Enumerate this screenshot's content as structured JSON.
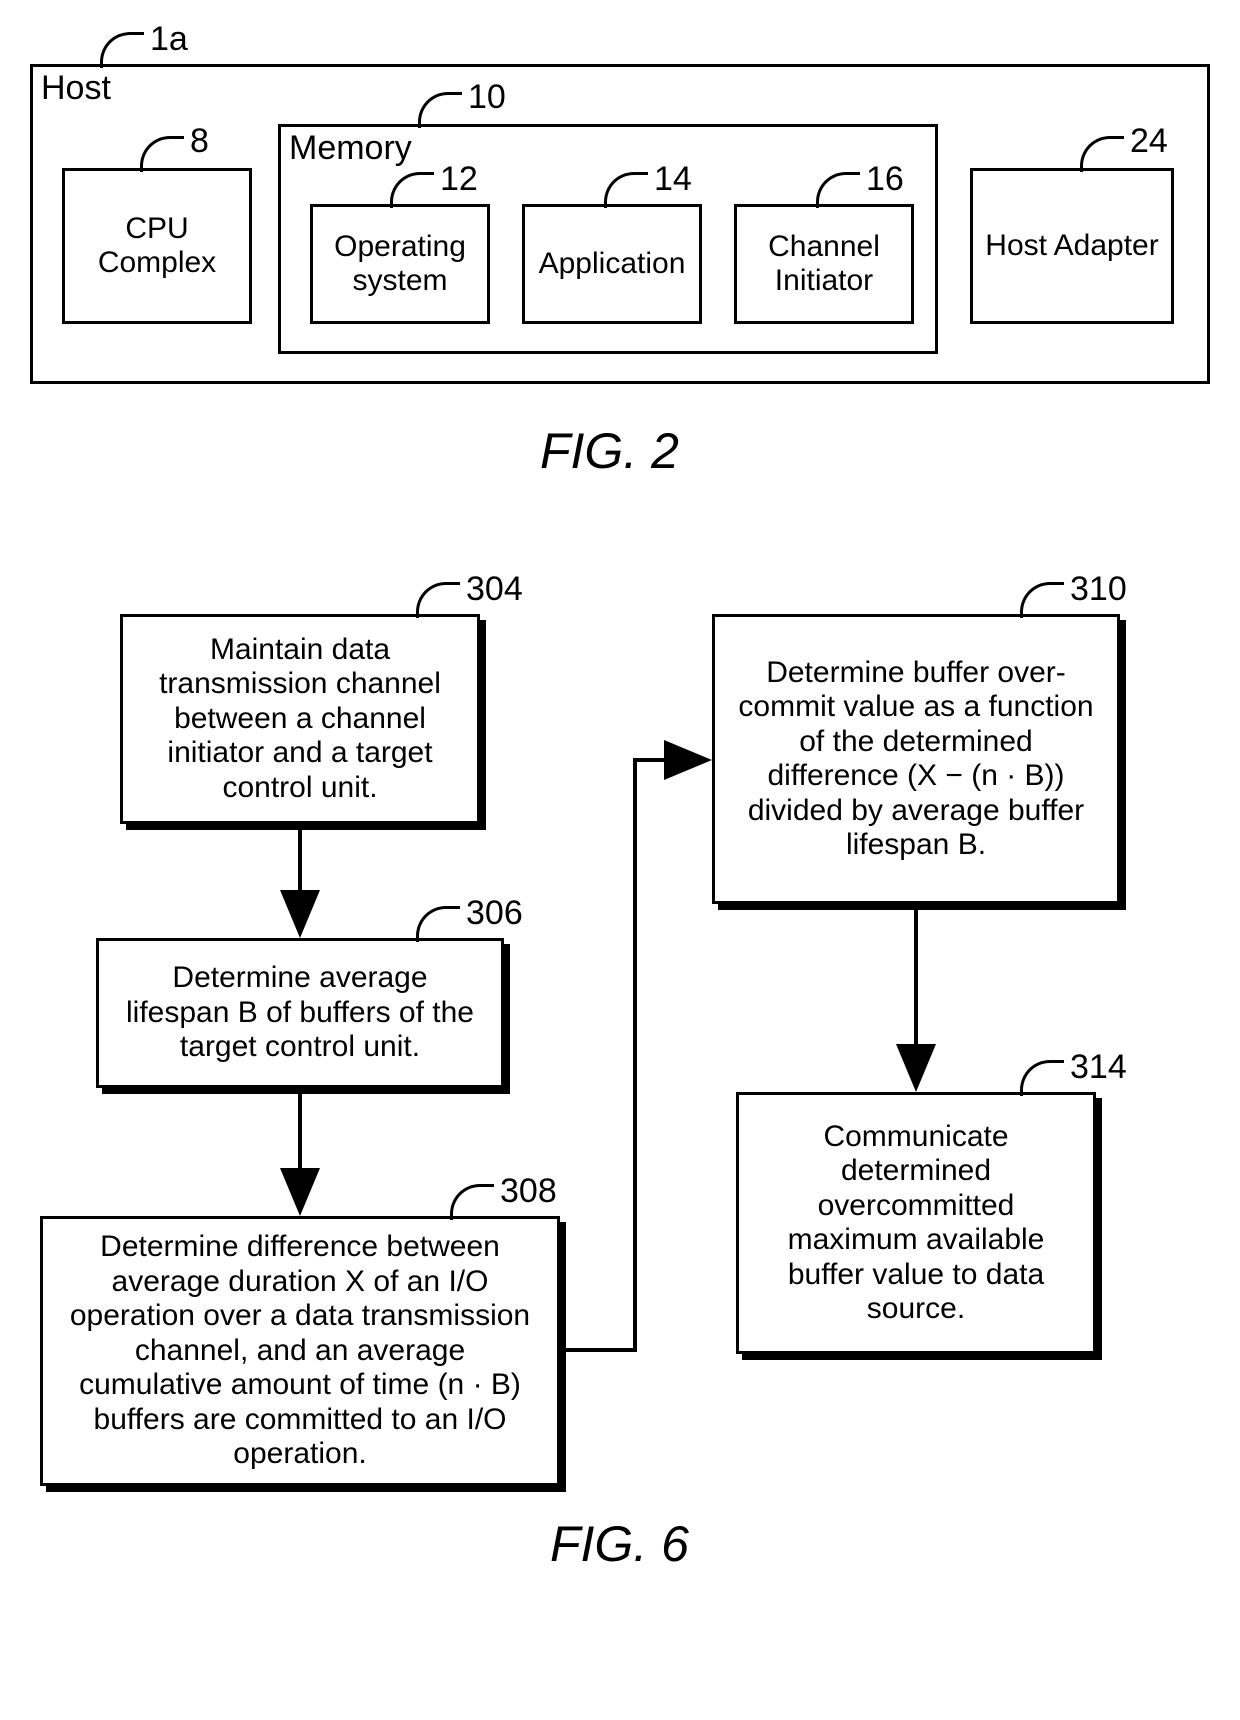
{
  "fig2": {
    "host_label": "Host",
    "host_ref": "1a",
    "cpu": {
      "label": "CPU Complex",
      "ref": "8"
    },
    "memory": {
      "label": "Memory",
      "ref": "10",
      "os": {
        "label": "Operating system",
        "ref": "12"
      },
      "app": {
        "label": "Application",
        "ref": "14"
      },
      "chinit": {
        "label": "Channel Initiator",
        "ref": "16"
      }
    },
    "adapter": {
      "label": "Host Adapter",
      "ref": "24"
    },
    "caption": "FIG. 2"
  },
  "fig6": {
    "step304": {
      "ref": "304",
      "text": "Maintain data transmission channel between a channel initiator and a target control unit."
    },
    "step306": {
      "ref": "306",
      "text": "Determine average lifespan B of buffers of the target control unit."
    },
    "step308": {
      "ref": "308",
      "text": "Determine difference between average duration X of an I/O operation over a data transmission channel, and an average cumulative amount of time (n · B) buffers are committed to an I/O operation."
    },
    "step310": {
      "ref": "310",
      "text": "Determine buffer over-commit value as a function of the determined difference (X − (n · B)) divided by average buffer lifespan B."
    },
    "step314": {
      "ref": "314",
      "text": "Communicate determined overcommitted maximum available buffer value to data source."
    },
    "caption": "FIG. 6"
  }
}
